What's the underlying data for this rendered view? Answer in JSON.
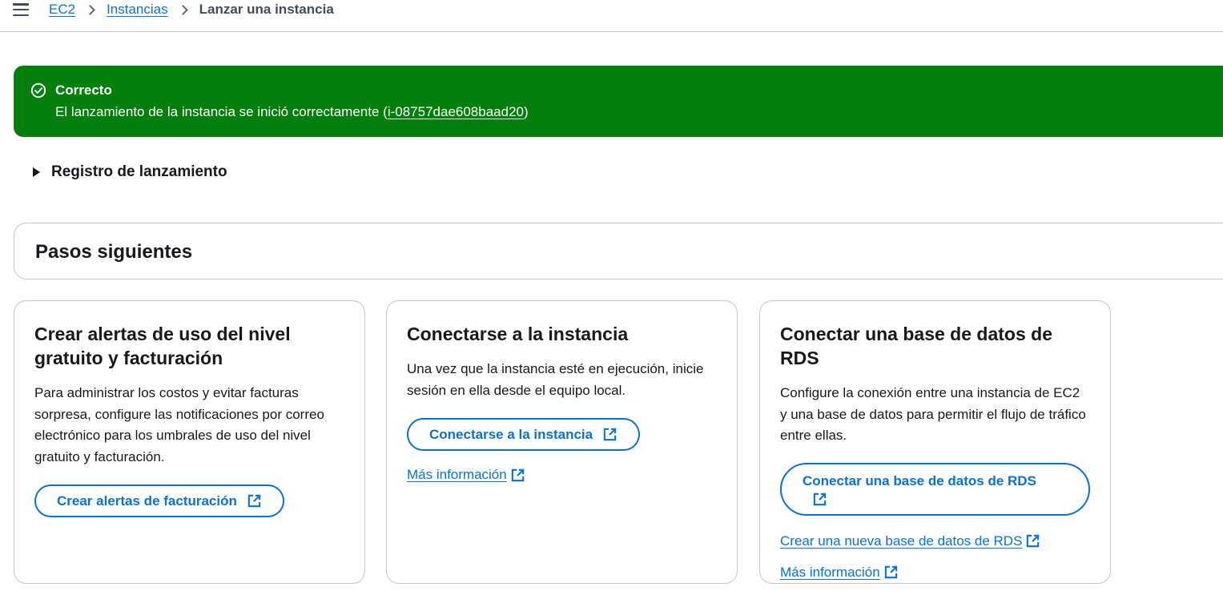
{
  "breadcrumb": {
    "items": [
      {
        "label": "EC2"
      },
      {
        "label": "Instancias"
      }
    ],
    "current": "Lanzar una instancia"
  },
  "flash": {
    "title": "Correcto",
    "message_prefix": "El lanzamiento de la instancia se inició correctamente (",
    "instance_id": "i-08757dae608baad20",
    "message_suffix": ")",
    "color": "#037f0c"
  },
  "launch_log": {
    "label": "Registro de lanzamiento"
  },
  "next_steps": {
    "title": "Pasos siguientes",
    "cards": [
      {
        "title": "Crear alertas de uso del nivel gratuito y facturación",
        "description": "Para administrar los costos y evitar facturas sorpresa, configure las notificaciones por correo electrónico para los umbrales de uso del nivel gratuito y facturación.",
        "button_label": "Crear alertas de facturación"
      },
      {
        "title": "Conectarse a la instancia",
        "description": "Una vez que la instancia esté en ejecución, inicie sesión en ella desde el equipo local.",
        "button_label": "Conectarse a la instancia",
        "link_label": "Más información"
      },
      {
        "title": "Conectar una base de datos de RDS",
        "description": "Configure la conexión entre una instancia de EC2 y una base de datos para permitir el flujo de tráfico entre ellas.",
        "button_label": "Conectar una base de datos de RDS",
        "links": [
          {
            "label": "Crear una nueva base de datos de RDS"
          },
          {
            "label": "Más información"
          }
        ]
      }
    ]
  },
  "colors": {
    "accent": "#0972d3",
    "success": "#037f0c",
    "border": "#c6c6cd"
  }
}
